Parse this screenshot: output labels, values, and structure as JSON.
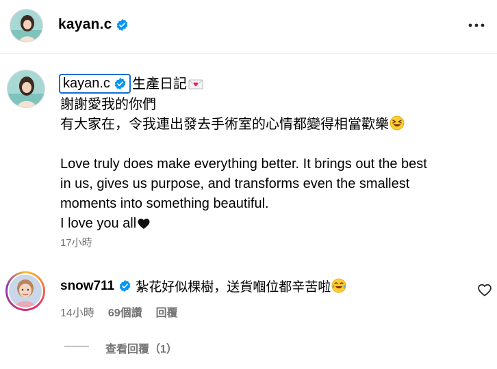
{
  "header": {
    "username": "kayan.c"
  },
  "caption": {
    "username": "kayan.c",
    "title": "生產日記",
    "lines": [
      "謝謝愛我的你們",
      "有大家在，令我連出發去手術室的心情都變得相當歡樂",
      "",
      "Love truly does make everything better. It brings out the best",
      "in us, gives us purpose, and transforms even the smallest",
      "moments into something beautiful.",
      "I love you all"
    ],
    "time": "17小時"
  },
  "comment": {
    "username": "snow711",
    "text": "紮花好似棵樹，送貨嗰位都辛苦啦",
    "time": "14小時",
    "likes": "69個讚",
    "reply_label": "回覆",
    "view_replies": "查看回覆（1）"
  },
  "icons": {
    "verified_color": "#0095f6",
    "heart_color": "#e0245e"
  }
}
